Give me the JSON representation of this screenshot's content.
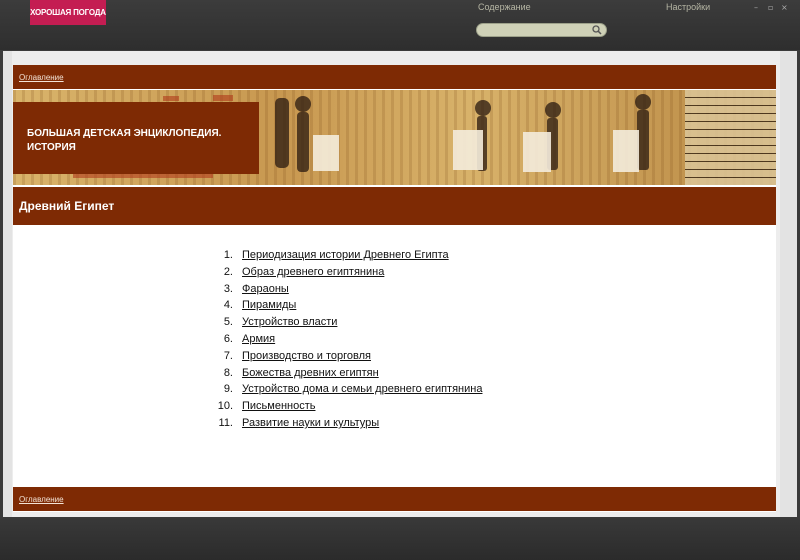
{
  "app": {
    "logo_text": "ХОРОШАЯ ПОГОДА",
    "menu": {
      "contents": "Содержание",
      "settings": "Настройки"
    },
    "window_controls": [
      "–",
      "▫",
      "×"
    ],
    "search": {
      "value": "",
      "placeholder": ""
    }
  },
  "page": {
    "top_link": "Оглавление",
    "bottom_link": "Оглавление",
    "banner_title_line1": "БОЛЬШАЯ ДЕТСКАЯ ЭНЦИКЛОПЕДИЯ.",
    "banner_title_line2": "ИСТОРИЯ",
    "section_title": "Древний Египет",
    "toc": [
      {
        "num": "1.",
        "label": "Периодизация истории Древнего Египта"
      },
      {
        "num": "2.",
        "label": "Образ древнего египтянина"
      },
      {
        "num": "3.",
        "label": "Фараоны"
      },
      {
        "num": "4.",
        "label": "Пирамиды"
      },
      {
        "num": "5.",
        "label": "Устройство власти"
      },
      {
        "num": "6.",
        "label": "Армия"
      },
      {
        "num": "7.",
        "label": "Производство и торговля"
      },
      {
        "num": "8.",
        "label": "Божества древних египтян"
      },
      {
        "num": "9.",
        "label": "Устройство дома и семьи древнего египтянина"
      },
      {
        "num": "10.",
        "label": "Письменность"
      },
      {
        "num": "11.",
        "label": "Развитие науки и культуры"
      }
    ]
  },
  "colors": {
    "accent": "#7e2a04",
    "logo": "#c41d52"
  }
}
